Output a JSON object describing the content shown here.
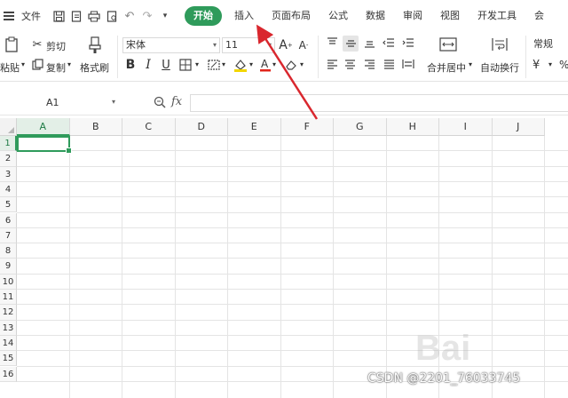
{
  "menubar": {
    "file_label": "文件",
    "tabs": [
      {
        "label": "开始",
        "active": true
      },
      {
        "label": "插入"
      },
      {
        "label": "页面布局"
      },
      {
        "label": "公式"
      },
      {
        "label": "数据"
      },
      {
        "label": "审阅"
      },
      {
        "label": "视图"
      },
      {
        "label": "开发工具"
      },
      {
        "label": "会"
      }
    ]
  },
  "ribbon": {
    "paste_label": "粘贴",
    "cut_label": "剪切",
    "copy_label": "复制",
    "format_painter_label": "格式刷",
    "font_name": "宋体",
    "font_size": "11",
    "merge_center_label": "合并居中",
    "wrap_text_label": "自动换行",
    "number_format": "常规",
    "currency_symbol": "¥",
    "percent_symbol": "%"
  },
  "formula_bar": {
    "name_box": "A1",
    "fx_label": "fx"
  },
  "grid": {
    "columns": [
      "A",
      "B",
      "C",
      "D",
      "E",
      "F",
      "G",
      "H",
      "I",
      "J"
    ],
    "rows": [
      "1",
      "2",
      "3",
      "4",
      "5",
      "6",
      "7",
      "8",
      "9",
      "10",
      "11",
      "12",
      "13",
      "14",
      "15",
      "16"
    ],
    "active_column": "A",
    "active_row": "1"
  },
  "watermark": {
    "text": "CSDN @2201_76033745",
    "brand": "Bai"
  },
  "colors": {
    "accent": "#2f9b5b",
    "arrow": "#d9272e"
  }
}
